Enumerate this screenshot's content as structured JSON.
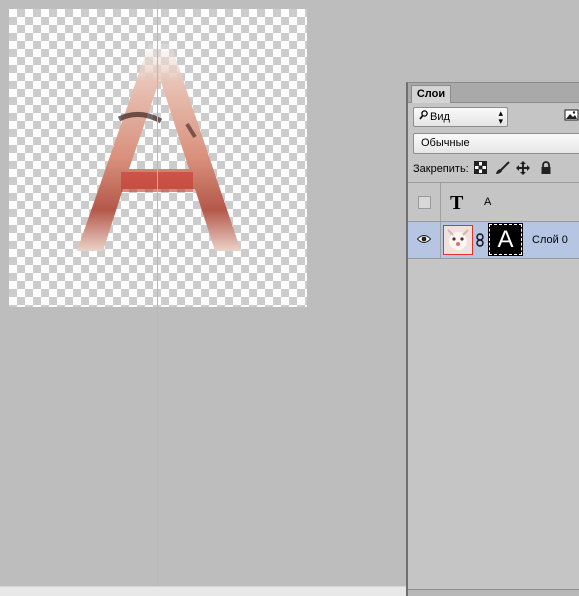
{
  "document": {
    "canvas": {
      "artwork_letter": "A",
      "transparency": "checkerboard",
      "guide_color": "#5fdede"
    }
  },
  "layers_panel": {
    "tab_label": "Слои",
    "filter": {
      "icon": "search-icon",
      "value": "Вид"
    },
    "image_filter_icon": "image-icon",
    "blend_mode": "Обычные",
    "lock_label": "Закрепить:",
    "lock_icons": [
      "lock-transparent-pixels-icon",
      "lock-image-pixels-icon",
      "lock-position-icon",
      "lock-all-icon"
    ],
    "layers": [
      {
        "type": "text",
        "icon_glyph": "T",
        "name": "A",
        "visible": false,
        "selected": false
      },
      {
        "type": "image",
        "name": "Слой 0",
        "visible": true,
        "selected": true,
        "mask_letter": "A"
      }
    ],
    "colors": {
      "selected_row": "#b6c6e2",
      "panel_bg": "#c5c5c5"
    }
  }
}
